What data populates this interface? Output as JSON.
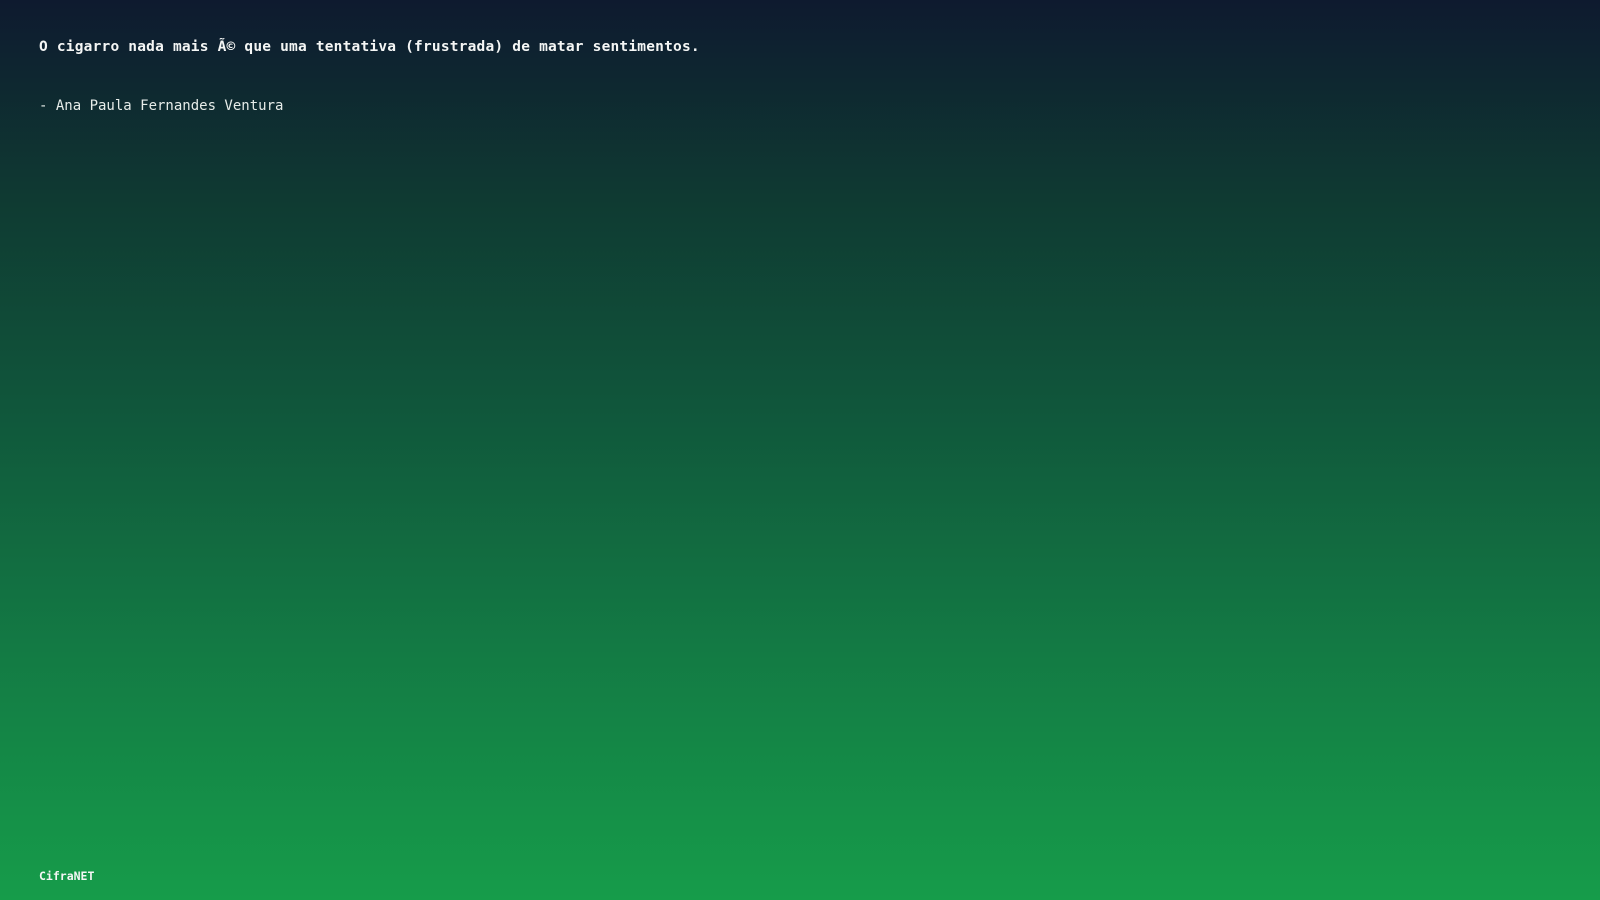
{
  "quote": {
    "text": "O cigarro nada mais Ã© que uma tentativa (frustrada) de matar sentimentos.",
    "author": "- Ana Paula Fernandes Ventura"
  },
  "footer": {
    "brand": "CifraNET"
  },
  "colors": {
    "gradient_top": "#0e1a2f",
    "gradient_bottom": "#169c4a",
    "text": "#f4f6f5"
  }
}
